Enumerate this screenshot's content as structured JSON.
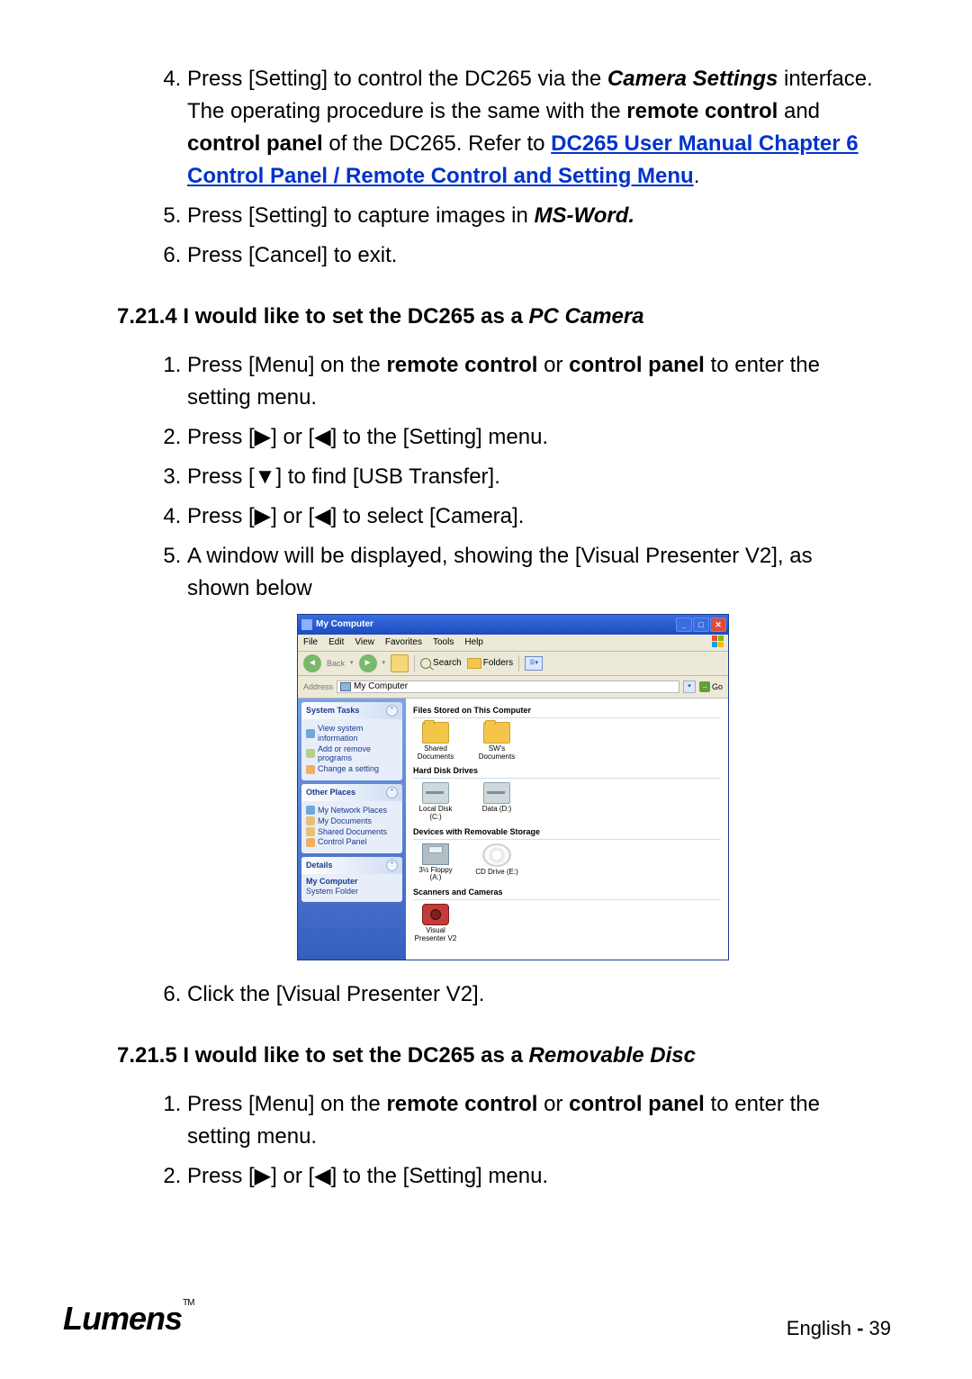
{
  "list1": {
    "start": 4,
    "item4_pre": "Press [Setting] to control the DC265 via the ",
    "item4_b1": "Camera Settings",
    "item4_mid1": " interface. The operating procedure is the same with the ",
    "item4_b2": "remote control",
    "item4_mid2": " and ",
    "item4_b3": "control panel",
    "item4_mid3": " of the DC265. Refer to ",
    "item4_link": "DC265 User Manual Chapter 6 Control Panel / Remote Control and Setting Menu",
    "item4_post": ".",
    "item5_pre": "Press [Setting] to capture images in ",
    "item5_b": "MS-Word.",
    "item6": "Press [Cancel] to exit."
  },
  "section4_no": "7.21.4",
  "section4_t1": " I would like to set the DC265 as a ",
  "section4_t2": "PC Camera",
  "list2": {
    "i1_pre": "Press [Menu] on the ",
    "i1_b1": "remote control",
    "i1_mid": " or ",
    "i1_b2": "control panel",
    "i1_post": " to enter the setting menu.",
    "i2": "Press [▶] or [◀] to the [Setting] menu.",
    "i3": "Press [▼] to find [USB Transfer].",
    "i4": "Press [▶] or [◀] to select [Camera].",
    "i5": "A window will be displayed, showing the [Visual Presenter V2], as shown below",
    "i6": "Click the [Visual Presenter V2]."
  },
  "section5_no": "7.21.5",
  "section5_t1": " I would like to set the DC265 as a ",
  "section5_t2": "Removable Disc",
  "list3": {
    "i1_pre": "Press [Menu] on the ",
    "i1_b1": "remote control",
    "i1_mid": " or ",
    "i1_b2": "control panel",
    "i1_post": " to enter the setting menu.",
    "i2": "Press [▶] or [◀] to the [Setting] menu."
  },
  "window": {
    "title": "My Computer",
    "menu": {
      "file": "File",
      "edit": "Edit",
      "view": "View",
      "fav": "Favorites",
      "tools": "Tools",
      "help": "Help"
    },
    "toolbar": {
      "back": "Back",
      "search": "Search",
      "folders": "Folders"
    },
    "address_label": "Address",
    "address_value": "My Computer",
    "go": "Go",
    "sidebar": {
      "tasks_title": "System Tasks",
      "t1": "View system information",
      "t2": "Add or remove programs",
      "t3": "Change a setting",
      "other_title": "Other Places",
      "o1": "My Network Places",
      "o2": "My Documents",
      "o3": "Shared Documents",
      "o4": "Control Panel",
      "details_title": "Details",
      "d1": "My Computer",
      "d2": "System Folder"
    },
    "groups": {
      "g1": "Files Stored on This Computer",
      "g1_i1": "Shared Documents",
      "g1_i2": "SW's Documents",
      "g2": "Hard Disk Drives",
      "g2_i1": "Local Disk (C:)",
      "g2_i2": "Data (D:)",
      "g3": "Devices with Removable Storage",
      "g3_i1": "3½ Floppy (A:)",
      "g3_i2": "CD Drive (E:)",
      "g4": "Scanners and Cameras",
      "g4_i1": "Visual Presenter V2"
    }
  },
  "footer": {
    "logo": "Lumens",
    "tm": "TM",
    "lang": "English",
    "dash": " - ",
    "page": "39"
  }
}
